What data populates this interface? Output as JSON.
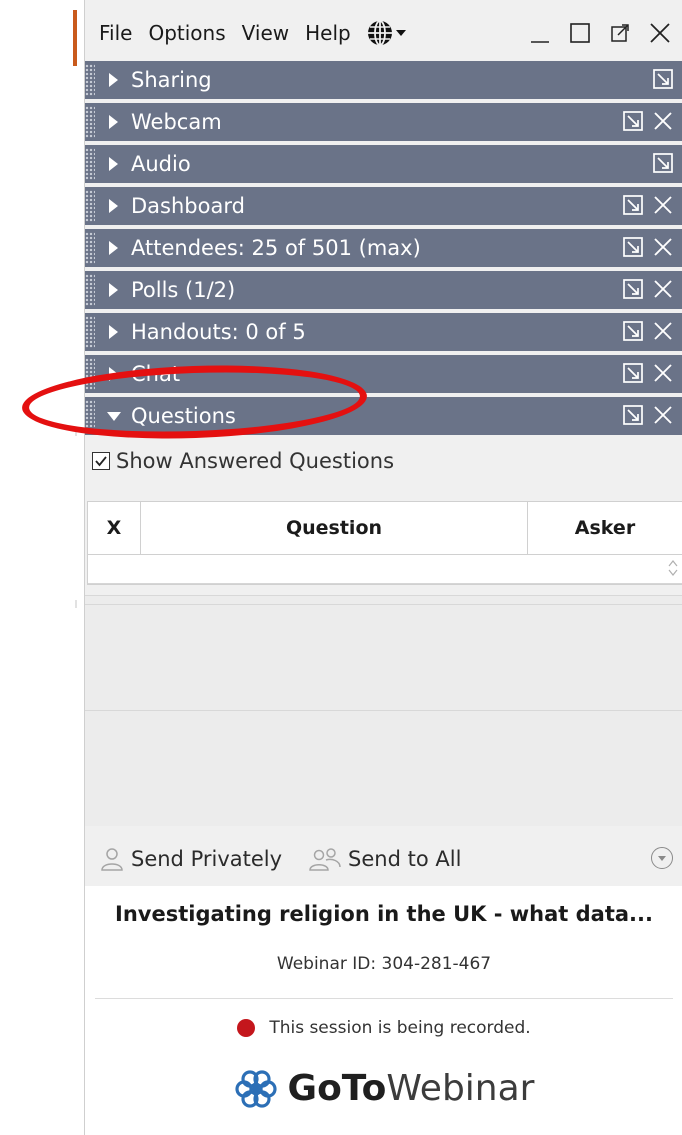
{
  "menubar": {
    "items": [
      "File",
      "Options",
      "View",
      "Help"
    ],
    "language_icon": "globe-icon",
    "window_controls": [
      "minimize-icon",
      "maximize-icon",
      "popout-icon",
      "close-icon"
    ]
  },
  "panes": [
    {
      "label": "Sharing",
      "expanded": false,
      "icons": [
        "popout-icon"
      ]
    },
    {
      "label": "Webcam",
      "expanded": false,
      "icons": [
        "popout-icon",
        "close-icon"
      ]
    },
    {
      "label": "Audio",
      "expanded": false,
      "icons": [
        "popout-icon"
      ]
    },
    {
      "label": "Dashboard",
      "expanded": false,
      "icons": [
        "popout-icon",
        "close-icon"
      ]
    },
    {
      "label": "Attendees:  25 of 501 (max)",
      "expanded": false,
      "icons": [
        "popout-icon",
        "close-icon"
      ]
    },
    {
      "label": "Polls (1/2)",
      "expanded": false,
      "icons": [
        "popout-icon",
        "close-icon"
      ]
    },
    {
      "label": "Handouts: 0 of 5",
      "expanded": false,
      "icons": [
        "popout-icon",
        "close-icon"
      ]
    },
    {
      "label": "Chat",
      "expanded": false,
      "icons": [
        "popout-icon",
        "close-icon"
      ]
    },
    {
      "label": "Questions",
      "expanded": true,
      "icons": [
        "popout-icon",
        "close-icon"
      ]
    }
  ],
  "questions": {
    "show_answered_label": "Show Answered Questions",
    "show_answered_checked": true,
    "columns": [
      "X",
      "Question",
      "Asker"
    ],
    "rows": [],
    "send_privately": "Send Privately",
    "send_to_all": "Send to All"
  },
  "footer": {
    "webinar_title": "Investigating religion in the UK - what data...",
    "webinar_id": "Webinar ID: 304-281-467",
    "recording_notice": "This session is being recorded.",
    "logo_bold": "GoTo",
    "logo_light": "Webinar"
  },
  "colors": {
    "pane_bar": "#6a7388",
    "recording_dot": "#c4161c",
    "annotation": "#e41010"
  }
}
